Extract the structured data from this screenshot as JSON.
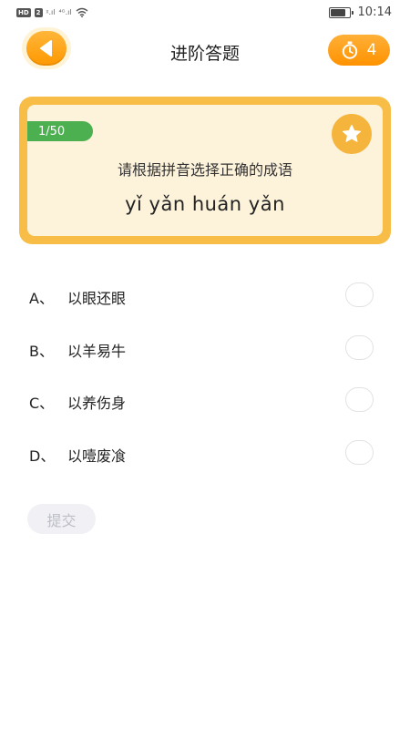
{
  "status_bar": {
    "badge_hd": "HD",
    "badge_2": "2",
    "signal_1": "ᵡ.ıl",
    "signal_2": "⁴ᴳ.ıl",
    "time": "10:14"
  },
  "header": {
    "title": "进阶答题",
    "timer_count": "4"
  },
  "question": {
    "progress": "1/50",
    "prompt": "请根据拼音选择正确的成语",
    "pinyin": "yǐ yǎn huán yǎn"
  },
  "options": [
    {
      "letter": "A、",
      "text": "以眼还眼"
    },
    {
      "letter": "B、",
      "text": "以羊易牛"
    },
    {
      "letter": "C、",
      "text": "以养伤身"
    },
    {
      "letter": "D、",
      "text": "以噎废飡"
    }
  ],
  "submit": {
    "label": "提交"
  },
  "colors": {
    "accent_orange": "#ff9800",
    "card_border": "#f7bd46",
    "card_bg": "#fdf2da",
    "progress_green": "#4caf50",
    "submit_disabled_bg": "#f1f1f5"
  }
}
